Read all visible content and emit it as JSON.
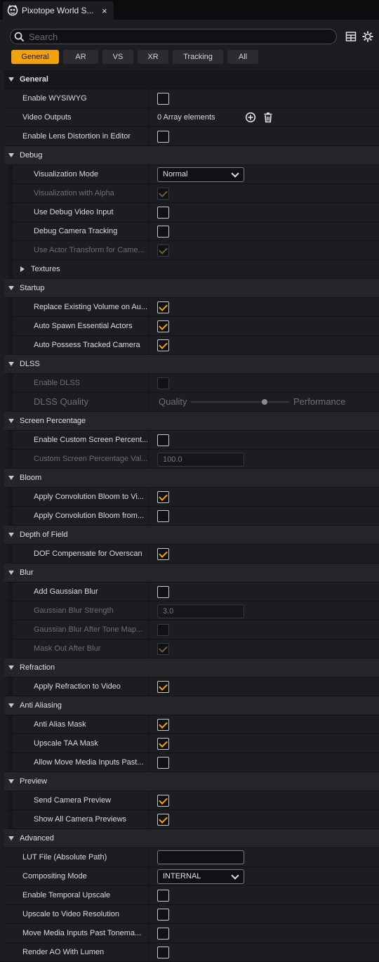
{
  "tab": {
    "title": "Pixotope World S...",
    "close": "×"
  },
  "search": {
    "placeholder": "Search"
  },
  "icons": {
    "table": "table-icon",
    "settings": "gear-icon",
    "add": "add-circle-icon",
    "delete": "trash-icon"
  },
  "colors": {
    "accent": "#f2a20c",
    "panel": "#1b1d21",
    "category": "#232529"
  },
  "filters": [
    {
      "label": "General",
      "active": true
    },
    {
      "label": "AR",
      "active": false
    },
    {
      "label": "VS",
      "active": false
    },
    {
      "label": "XR",
      "active": false
    },
    {
      "label": "Tracking",
      "active": false
    },
    {
      "label": "All",
      "active": false
    }
  ],
  "rows": [
    {
      "type": "cat",
      "top": true,
      "label": "General"
    },
    {
      "type": "prop",
      "level": 1,
      "label": "Enable WYSIWYG",
      "widget": "checkbox",
      "checked": false
    },
    {
      "type": "prop",
      "level": 1,
      "label": "Video Outputs",
      "widget": "array",
      "value": "0 Array elements"
    },
    {
      "type": "prop",
      "level": 1,
      "label": "Enable Lens Distortion in Editor",
      "widget": "checkbox",
      "checked": false
    },
    {
      "type": "cat",
      "label": "Debug"
    },
    {
      "type": "prop",
      "level": 2,
      "label": "Visualization Mode",
      "widget": "combo",
      "value": "Normal"
    },
    {
      "type": "prop",
      "level": 2,
      "label": "Visualization with Alpha",
      "widget": "checkbox",
      "checked": true,
      "disabled": true
    },
    {
      "type": "prop",
      "level": 2,
      "label": "Use Debug Video Input",
      "widget": "checkbox",
      "checked": false
    },
    {
      "type": "prop",
      "level": 2,
      "label": "Debug Camera Tracking",
      "widget": "checkbox",
      "checked": false
    },
    {
      "type": "prop",
      "level": 2,
      "label": "Use Actor Transform for Came...",
      "widget": "checkbox",
      "checked": true,
      "disabled": true
    },
    {
      "type": "sub",
      "label": "Textures"
    },
    {
      "type": "cat",
      "label": "Startup"
    },
    {
      "type": "prop",
      "level": 2,
      "label": "Replace Existing Volume on Au...",
      "widget": "checkbox",
      "checked": true
    },
    {
      "type": "prop",
      "level": 2,
      "label": "Auto Spawn Essential Actors",
      "widget": "checkbox",
      "checked": true
    },
    {
      "type": "prop",
      "level": 2,
      "label": "Auto Possess Tracked Camera",
      "widget": "checkbox",
      "checked": true
    },
    {
      "type": "cat",
      "label": "DLSS"
    },
    {
      "type": "prop",
      "level": 2,
      "label": "Enable DLSS",
      "widget": "checkbox",
      "checked": false,
      "disabled": true
    },
    {
      "type": "prop",
      "level": 2,
      "label": "DLSS Quality",
      "widget": "slider",
      "left": "Quality",
      "right": "Performance",
      "level_value": 0.75,
      "disabled": true,
      "big": true
    },
    {
      "type": "cat",
      "label": "Screen Percentage"
    },
    {
      "type": "prop",
      "level": 2,
      "label": "Enable Custom Screen Percent...",
      "widget": "checkbox",
      "checked": false
    },
    {
      "type": "prop",
      "level": 2,
      "label": "Custom Screen Percentage Val...",
      "widget": "number",
      "value": "100.0",
      "disabled": true
    },
    {
      "type": "cat",
      "label": "Bloom"
    },
    {
      "type": "prop",
      "level": 2,
      "label": "Apply Convolution Bloom to Vi...",
      "widget": "checkbox",
      "checked": true
    },
    {
      "type": "prop",
      "level": 2,
      "label": "Apply Convolution Bloom from...",
      "widget": "checkbox",
      "checked": false
    },
    {
      "type": "cat",
      "label": "Depth of Field"
    },
    {
      "type": "prop",
      "level": 2,
      "label": "DOF Compensate for Overscan",
      "widget": "checkbox",
      "checked": true
    },
    {
      "type": "cat",
      "label": "Blur"
    },
    {
      "type": "prop",
      "level": 2,
      "label": "Add Gaussian Blur",
      "widget": "checkbox",
      "checked": false
    },
    {
      "type": "prop",
      "level": 2,
      "label": "Gaussian Blur Strength",
      "widget": "number",
      "value": "3.0",
      "disabled": true
    },
    {
      "type": "prop",
      "level": 2,
      "label": "Gaussian Blur After Tone Map...",
      "widget": "checkbox",
      "checked": false,
      "disabled": true
    },
    {
      "type": "prop",
      "level": 2,
      "label": "Mask Out After Blur",
      "widget": "checkbox",
      "checked": true,
      "disabled": true
    },
    {
      "type": "cat",
      "label": "Refraction"
    },
    {
      "type": "prop",
      "level": 2,
      "label": "Apply Refraction to Video",
      "widget": "checkbox",
      "checked": true
    },
    {
      "type": "cat",
      "label": "Anti Aliasing"
    },
    {
      "type": "prop",
      "level": 2,
      "label": "Anti Alias Mask",
      "widget": "checkbox",
      "checked": true
    },
    {
      "type": "prop",
      "level": 2,
      "label": "Upscale TAA Mask",
      "widget": "checkbox",
      "checked": true
    },
    {
      "type": "prop",
      "level": 2,
      "label": "Allow Move Media Inputs Past...",
      "widget": "checkbox",
      "checked": false
    },
    {
      "type": "cat",
      "label": "Preview"
    },
    {
      "type": "prop",
      "level": 2,
      "label": "Send Camera Preview",
      "widget": "checkbox",
      "checked": true
    },
    {
      "type": "prop",
      "level": 2,
      "label": "Show All Camera Previews",
      "widget": "checkbox",
      "checked": true
    },
    {
      "type": "cat",
      "label": "Advanced"
    },
    {
      "type": "prop",
      "level": 1,
      "label": "LUT File (Absolute Path)",
      "widget": "text",
      "value": ""
    },
    {
      "type": "prop",
      "level": 1,
      "label": "Compositing Mode",
      "widget": "combo",
      "value": "INTERNAL"
    },
    {
      "type": "prop",
      "level": 1,
      "label": "Enable Temporal Upscale",
      "widget": "checkbox",
      "checked": false
    },
    {
      "type": "prop",
      "level": 1,
      "label": "Upscale to Video Resolution",
      "widget": "checkbox",
      "checked": false
    },
    {
      "type": "prop",
      "level": 1,
      "label": "Move Media Inputs Past Tonema...",
      "widget": "checkbox",
      "checked": false
    },
    {
      "type": "prop",
      "level": 1,
      "label": "Render AO With Lumen",
      "widget": "checkbox",
      "checked": false
    }
  ]
}
